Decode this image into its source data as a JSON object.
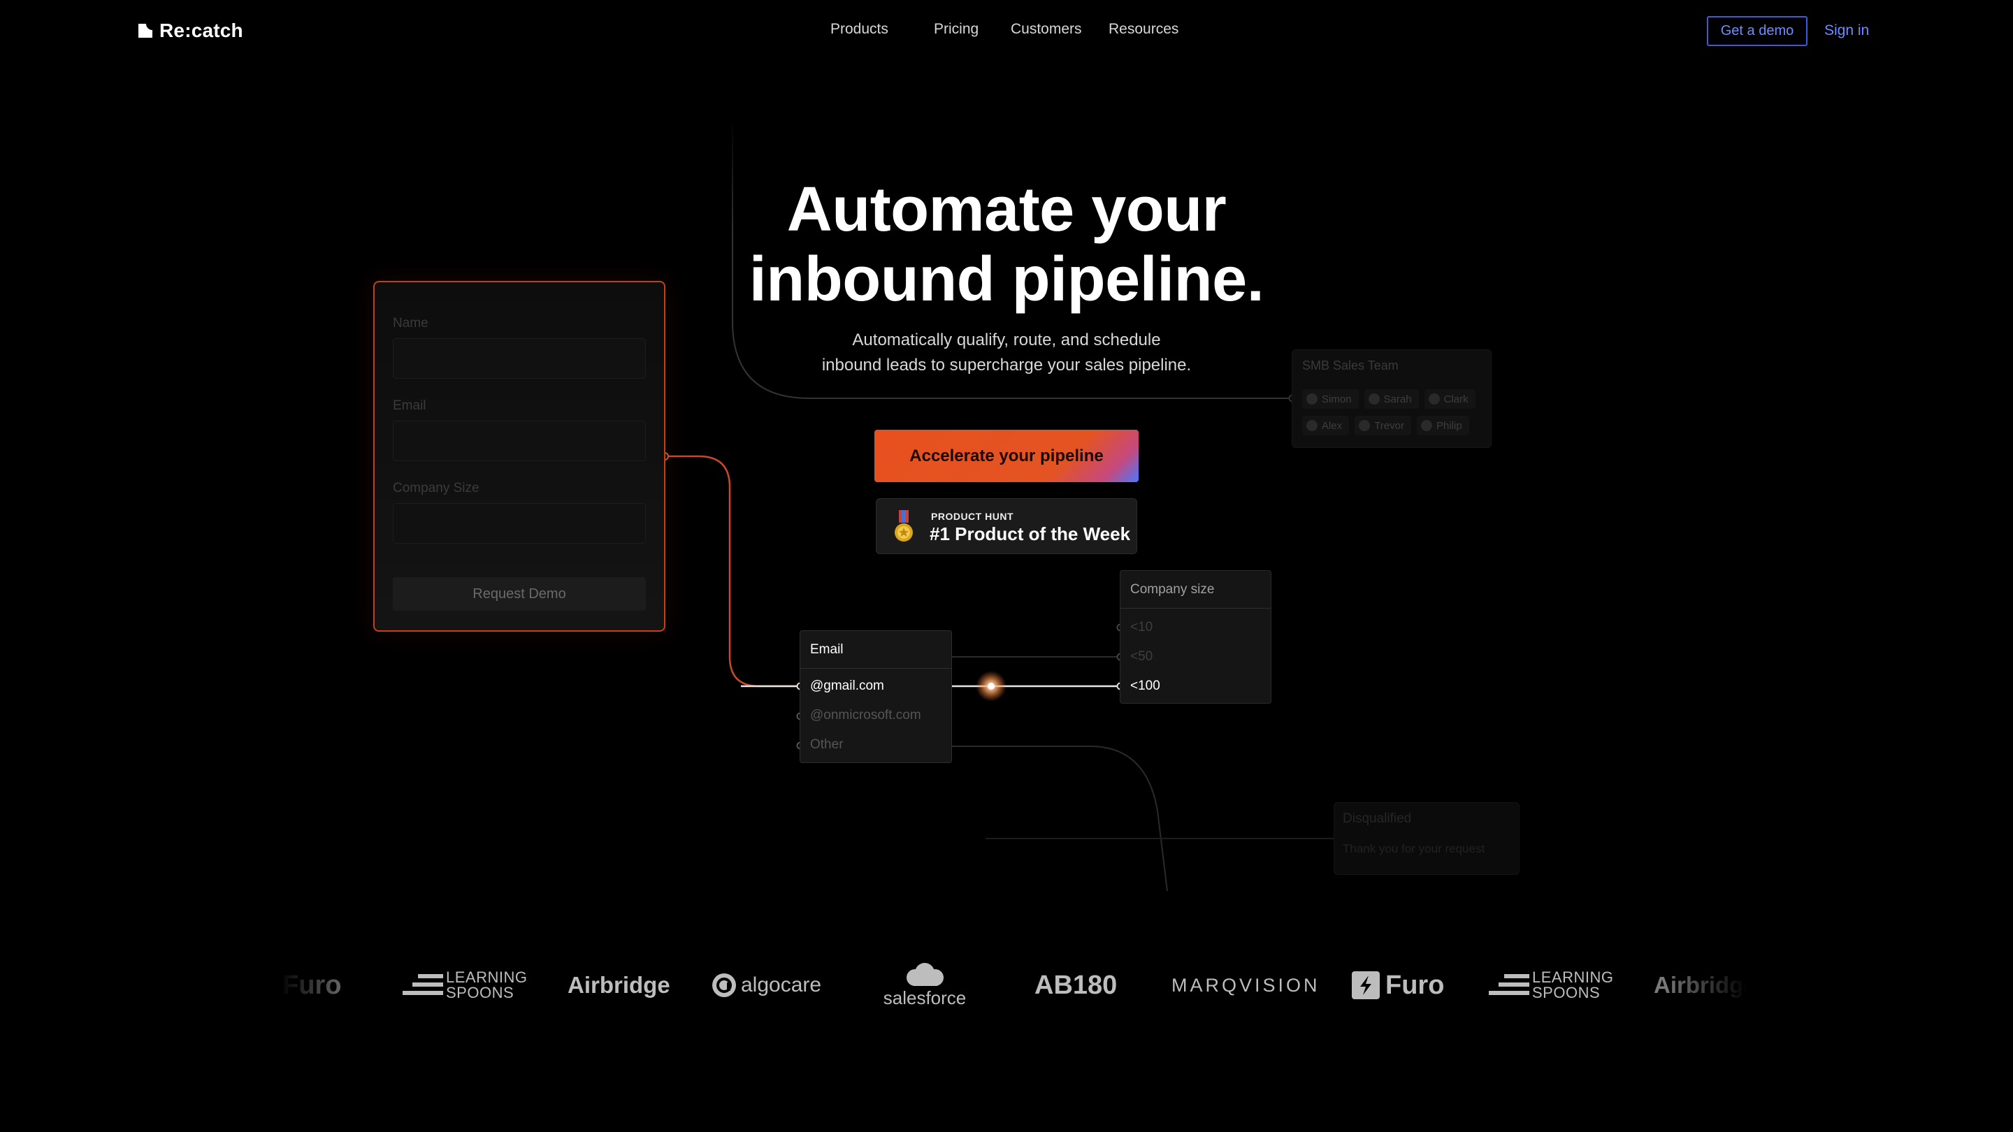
{
  "brand": {
    "name": "Re:catch"
  },
  "nav": {
    "links": [
      "Products",
      "Pricing",
      "Customers",
      "Resources"
    ],
    "demo_button": "Get a demo",
    "signin": "Sign in"
  },
  "hero": {
    "title_line1": "Automate your",
    "title_line2": "inbound pipeline.",
    "subtitle_line1": "Automatically qualify, route, and schedule",
    "subtitle_line2": "inbound leads to supercharge your sales pipeline.",
    "cta": "Accelerate your pipeline",
    "badge_small": "PRODUCT HUNT",
    "badge_big": "#1 Product of the Week"
  },
  "form_card": {
    "name_label": "Name",
    "email_label": "Email",
    "company_label": "Company Size",
    "button": "Request Demo"
  },
  "email_node": {
    "title": "Email",
    "options": [
      "@gmail.com",
      "@onmicrosoft.com",
      "Other"
    ]
  },
  "company_node": {
    "title": "Company size",
    "options": [
      "<10",
      "<50",
      "<100"
    ]
  },
  "smb_card": {
    "title": "SMB Sales Team",
    "people": [
      "Simon",
      "Sarah",
      "Clark",
      "Alex",
      "Trevor",
      "Philip"
    ]
  },
  "disqualified": {
    "title": "Disqualified",
    "text": "Thank you for your request"
  },
  "logos": [
    "Furo",
    "LEARNING SPOONS",
    "Airbridge",
    "algocare",
    "salesforce",
    "AB180",
    "MARQVISION",
    "Furo",
    "LEARNING SPOONS",
    "Airbridge"
  ],
  "colors": {
    "accent_orange": "#e8501f",
    "accent_blue": "#3b5bdb",
    "background": "#000000"
  }
}
